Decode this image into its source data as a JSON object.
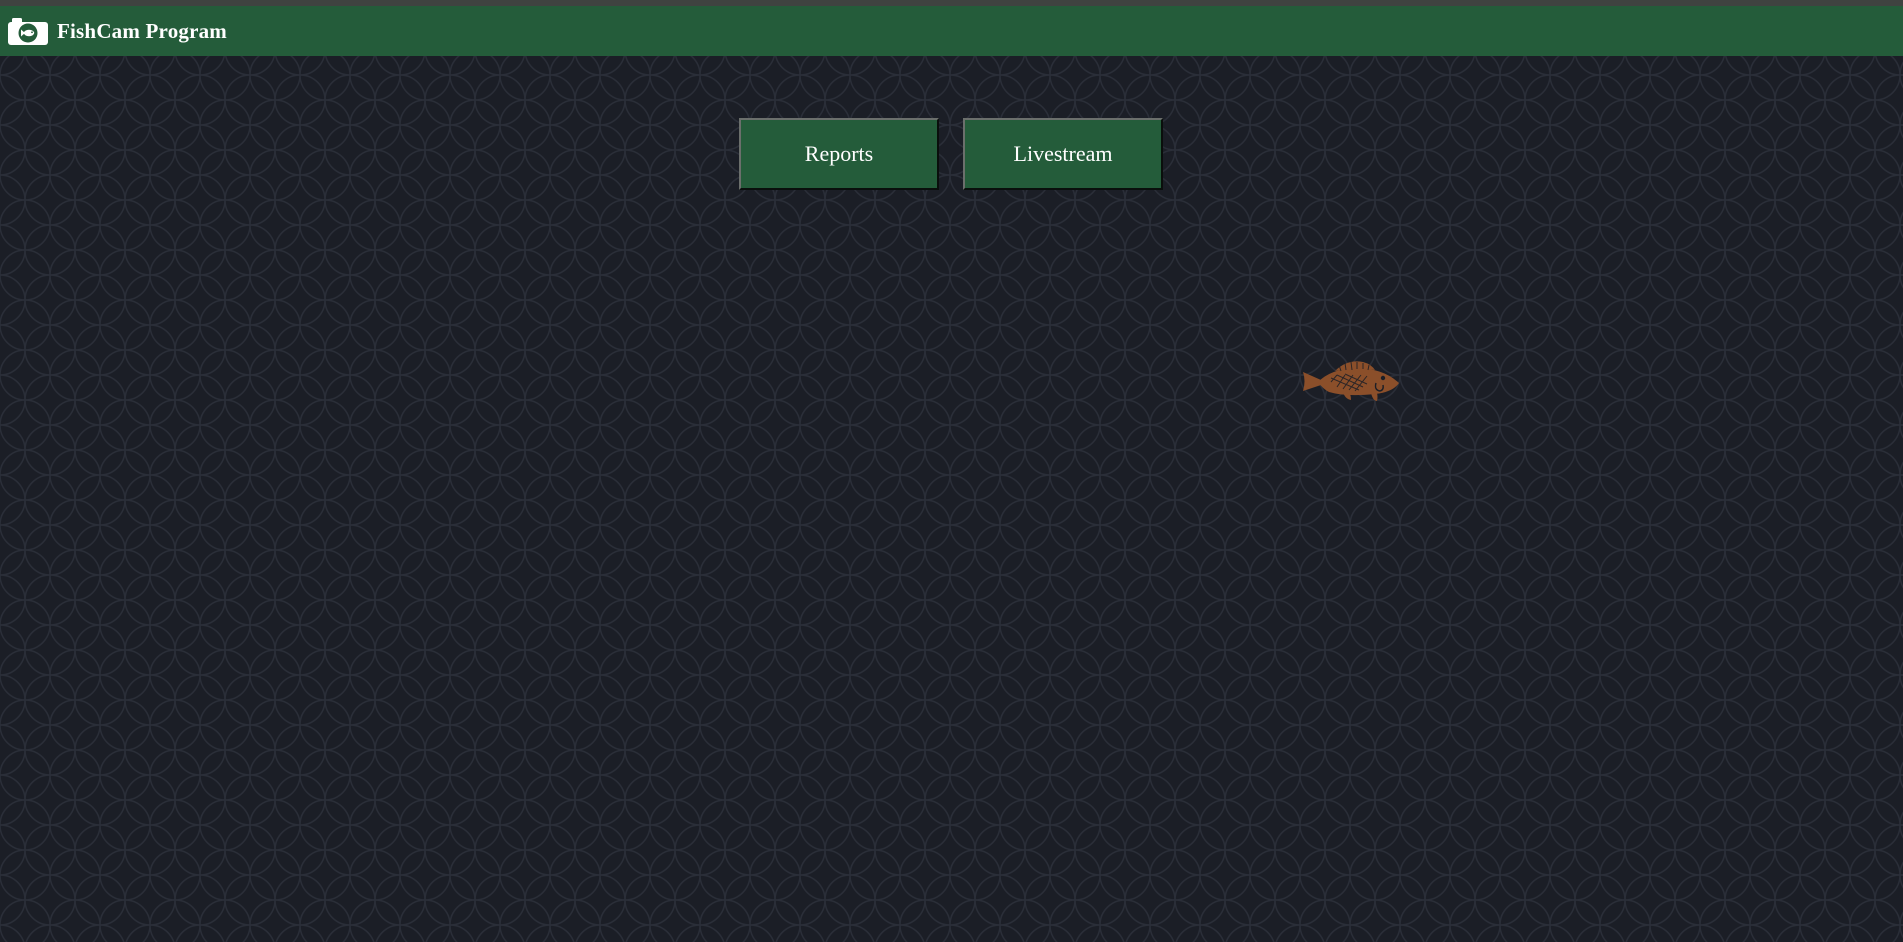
{
  "app": {
    "title": "FishCam Program",
    "logo_icon": "camera-fish-icon"
  },
  "nav": {
    "buttons": [
      {
        "label": "Reports"
      },
      {
        "label": "Livestream"
      }
    ]
  },
  "decorations": {
    "fish_icon": "fish-icon"
  },
  "colors": {
    "header_bg": "#245c3a",
    "page_bg": "#1b1e26",
    "fish": "#8b4f2a",
    "button_text": "#ffffff"
  }
}
